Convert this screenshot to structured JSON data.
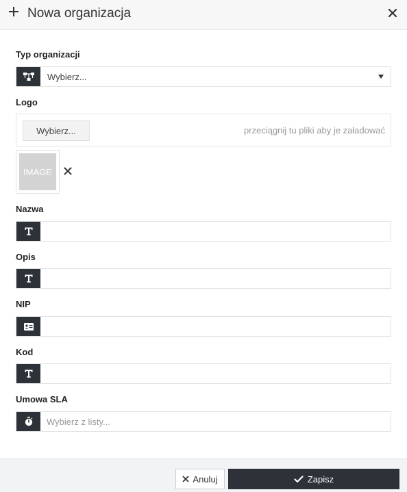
{
  "header": {
    "title": "Nowa organizacja",
    "icons": {
      "add": "plus-icon",
      "close": "close-icon"
    }
  },
  "fields": {
    "type": {
      "label": "Typ organizacji",
      "placeholder": "Wybierz...",
      "icon": "org-hierarchy-icon"
    },
    "logo": {
      "label": "Logo",
      "choose_button": "Wybierz...",
      "drop_hint": "przeciągnij tu pliki aby je załadować",
      "preview_text": "IMAGE"
    },
    "name": {
      "label": "Nazwa",
      "value": "",
      "icon": "text-icon"
    },
    "description": {
      "label": "Opis",
      "value": "",
      "icon": "text-icon"
    },
    "nip": {
      "label": "NIP",
      "value": "",
      "icon": "id-card-icon"
    },
    "code": {
      "label": "Kod",
      "value": "",
      "icon": "text-icon"
    },
    "sla": {
      "label": "Umowa SLA",
      "placeholder": "Wybierz z listy...",
      "icon": "stopwatch-icon"
    }
  },
  "footer": {
    "cancel_label": "Anuluj",
    "save_label": "Zapisz"
  },
  "colors": {
    "addon_bg": "#2d3138",
    "header_bg": "#f7f7f7",
    "footer_bg": "#f2f3f5",
    "image_placeholder": "#d3d3d3"
  }
}
